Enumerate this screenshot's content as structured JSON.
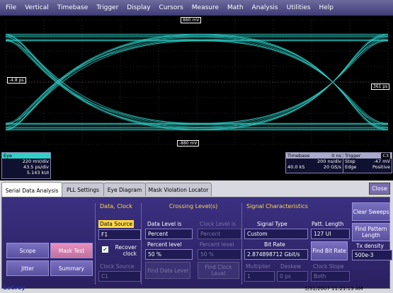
{
  "menu": [
    "File",
    "Vertical",
    "Timebase",
    "Trigger",
    "Display",
    "Cursors",
    "Measure",
    "Math",
    "Analysis",
    "Utilities",
    "Help"
  ],
  "grid": {
    "top_label": "880 mV",
    "bottom_label": "-880 mV",
    "left_label": "-4.8 ps",
    "right_label": "361 ps",
    "trace_color": "#2fd0c8"
  },
  "eye_box": {
    "title": "Eye",
    "rows": [
      "220 mV/div",
      "43.5 ps/div",
      "5.143 kUI"
    ]
  },
  "timebase": {
    "title": "Timebase",
    "offset": "0 ns",
    "rows": [
      [
        "",
        "200 ns/div"
      ],
      [
        "40.0 kS",
        "20 GS/s"
      ]
    ]
  },
  "trigger": {
    "title": "Trigger",
    "badge": "C3",
    "rows": [
      [
        "Stop",
        "-47 mV"
      ],
      [
        "Edge",
        "Positive"
      ]
    ]
  },
  "tabs": [
    "Serial Data Analysis",
    "PLL Settings",
    "Eye Diagram",
    "Mask Violation Locator"
  ],
  "close_label": "Close",
  "left_buttons": {
    "scope": "Scope",
    "mask_test": "Mask Test",
    "jitter": "Jitter",
    "summary": "Summary"
  },
  "data_clock": {
    "title": "Data, Clock",
    "data_source_label": "Data Source",
    "data_source_value": "F1",
    "recover_clock_label": "Recover clock",
    "clock_source_label": "Clock Source",
    "clock_source_value": "C1"
  },
  "crossing": {
    "title": "Crossing Level(s)",
    "data_level_label": "Data Level is",
    "data_level_value": "Percent",
    "percent_label": "Percent level",
    "percent_value": "50 %",
    "find_data_level": "Find Data Level",
    "clock_level_label": "Clock Level is",
    "clock_level_value": "Percent",
    "clock_percent_label": "Percent level",
    "clock_percent_value": "50 %",
    "find_clock_level": "Find Clock Level"
  },
  "signal": {
    "title": "Signal Characteristics",
    "signal_type_label": "Signal Type",
    "signal_type_value": "Custom",
    "patt_length_label": "Patt. Length",
    "patt_length_value": "127 UI",
    "bit_rate_label": "Bit Rate",
    "bit_rate_value": "2.874898712 Gbit/s",
    "find_bit_rate": "Find Bit Rate",
    "multiplier_label": "Multiplier",
    "multiplier_value": "1",
    "deskew_label": "Deskew",
    "deskew_value": "0 ps",
    "clock_slope_label": "Clock Slope",
    "clock_slope_value": "Both"
  },
  "right_controls": {
    "clear_sweeps": "Clear Sweeps",
    "find_pattern_length": "Find Pattern Length",
    "tx_density_label": "Tx density",
    "tx_density_value": "500e-3"
  },
  "status": {
    "logo": "LeCroy",
    "timestamp": "5/31/2007 11:21:13 AM"
  }
}
